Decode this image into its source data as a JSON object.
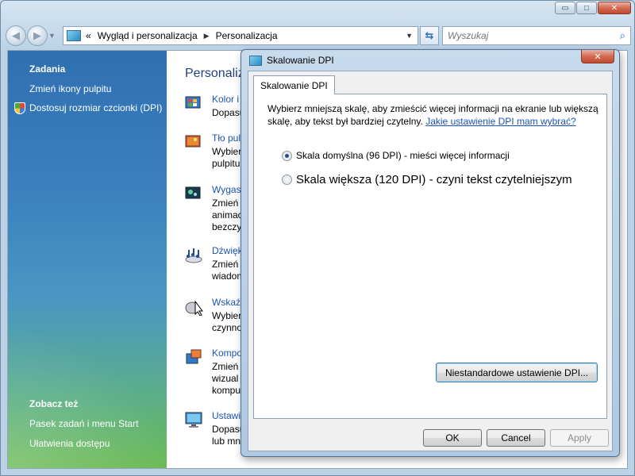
{
  "window": {
    "caption_min": "▭",
    "caption_max": "□",
    "caption_close": "✕"
  },
  "nav": {
    "back": "◀",
    "forward": "▶",
    "history": "▼",
    "breadcrumb_prefix": "«",
    "breadcrumb": [
      "Wygląd i personalizacja",
      "Personalizacja"
    ],
    "separator": "▶",
    "address_dropdown": "▼",
    "refresh": "⇆",
    "search_placeholder": "Wyszukaj",
    "search_icon": "⌕"
  },
  "sidebar": {
    "tasks_heading": "Zadania",
    "tasks": [
      {
        "label": "Zmień ikony pulpitu"
      },
      {
        "label": "Dostosuj rozmiar czcionki (DPI)",
        "icon": "shield-icon"
      }
    ],
    "see_also_heading": "Zobacz też",
    "see_also": [
      {
        "label": "Pasek zadań i menu Start"
      },
      {
        "label": "Ułatwienia dostępu"
      }
    ]
  },
  "main": {
    "title": "Personaliz",
    "items": [
      {
        "title": "Kolor i",
        "lines": [
          "Dopasu"
        ],
        "icon": "color-palette-icon"
      },
      {
        "title": "Tło pulp",
        "lines": [
          "Wybier",
          "pulpitu"
        ],
        "icon": "desktop-background-icon"
      },
      {
        "title": "Wygasz",
        "lines": [
          "Zmień",
          "animac",
          "bezczyn"
        ],
        "icon": "screensaver-icon"
      },
      {
        "title": "Dźwięk",
        "lines": [
          "Zmień",
          "wiadom"
        ],
        "icon": "sounds-icon"
      },
      {
        "title": "Wskaźn",
        "lines": [
          "Wybier",
          "czynno"
        ],
        "icon": "mouse-pointer-icon"
      },
      {
        "title": "Kompo",
        "lines": [
          "Zmień",
          "wizual",
          "kompu"
        ],
        "icon": "theme-icon"
      },
      {
        "title": "Ustawi",
        "lines": [
          "Dopasu",
          "lub mn"
        ],
        "icon": "display-settings-icon"
      }
    ]
  },
  "dialog": {
    "title": "Skalowanie DPI",
    "close": "✕",
    "tab": "Skalowanie DPI",
    "description": "Wybierz mniejszą skalę, aby zmieścić więcej informacji na ekranie lub większą skalę, aby tekst był bardziej czytelny.",
    "help_link": "Jakie ustawienie DPI mam wybrać?",
    "options": [
      {
        "label": "Skala domyślna (96 DPI) - mieści więcej informacji",
        "selected": true
      },
      {
        "label": "Skala większa (120 DPI) - czyni tekst czytelniejszym",
        "selected": false
      }
    ],
    "custom_button": "Niestandardowe ustawienie DPI...",
    "ok": "OK",
    "cancel": "Cancel",
    "apply": "Apply"
  }
}
